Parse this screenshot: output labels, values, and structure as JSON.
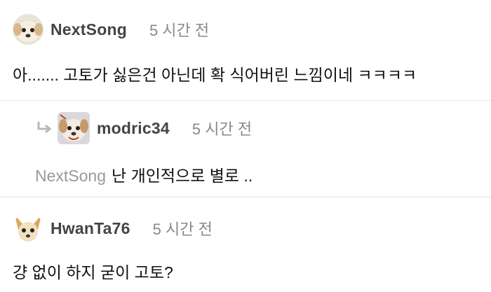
{
  "comments": [
    {
      "username": "NextSong",
      "time": "5 시간 전",
      "text": "아....... 고토가 싫은건 아닌데 확 식어버린 느낌이네 ㅋㅋㅋㅋ",
      "avatar_icon": "puppy-avatar-icon"
    },
    {
      "username": "modric34",
      "time": "5 시간 전",
      "mention": "NextSong",
      "text": "난 개인적으로 별로 ..",
      "avatar_icon": "dog-avatar-icon",
      "reply_icon": "reply-arrow-icon"
    },
    {
      "username": "HwanTa76",
      "time": "5 시간 전",
      "text": "걍 없이 하지 굳이 고토?",
      "avatar_icon": "chihuahua-avatar-icon"
    }
  ]
}
